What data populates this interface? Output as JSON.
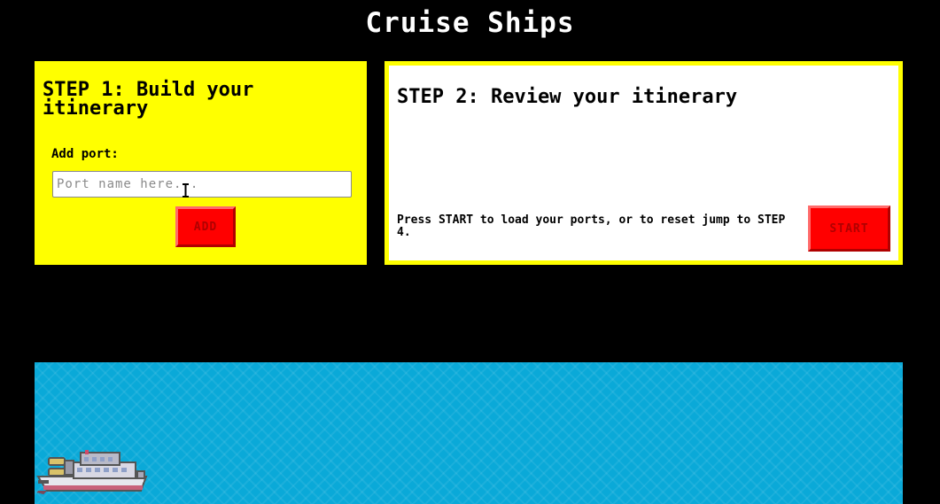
{
  "header": {
    "title": "Cruise Ships"
  },
  "step1": {
    "heading": "STEP 1: Build your itinerary",
    "add_port_label": "Add port:",
    "port_input": {
      "placeholder": "Port name here...",
      "value": ""
    },
    "add_button_label": "ADD"
  },
  "step2": {
    "heading": "STEP 2: Review your itinerary",
    "instructions": "Press START to load your ports, or to reset jump to STEP 4.",
    "start_button_label": "START"
  },
  "scene": {
    "sea_color": "#0aa9d8",
    "ship_icon": "cruise-ship-icon"
  },
  "colors": {
    "panel_yellow": "#ffff00",
    "button_red": "#ff0000",
    "background": "#000000"
  }
}
